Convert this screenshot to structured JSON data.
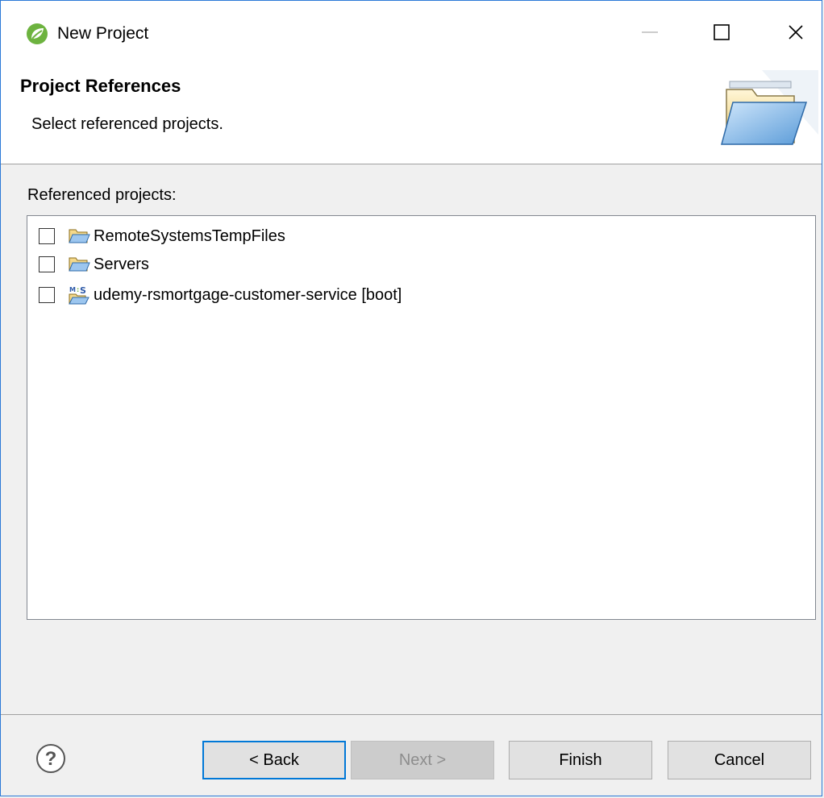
{
  "window": {
    "title": "New Project",
    "controls": {
      "minimize": "minimize",
      "maximize": "maximize",
      "close": "close"
    }
  },
  "banner": {
    "title": "Project References",
    "description": "Select referenced projects."
  },
  "references": {
    "label": "Referenced projects:",
    "items": [
      {
        "label": "RemoteSystemsTempFiles",
        "checked": false,
        "icon": "folder-open-icon"
      },
      {
        "label": "Servers",
        "checked": false,
        "icon": "folder-open-icon"
      },
      {
        "label": "udemy-rsmortgage-customer-service [boot]",
        "checked": false,
        "icon": "maven-spring-project-icon"
      }
    ]
  },
  "buttons": {
    "back": "< Back",
    "next": "Next >",
    "finish": "Finish",
    "cancel": "Cancel"
  },
  "colors": {
    "accent": "#0078d7",
    "window_border": "#2b79d7",
    "disabled_text": "#8d8d8d"
  }
}
